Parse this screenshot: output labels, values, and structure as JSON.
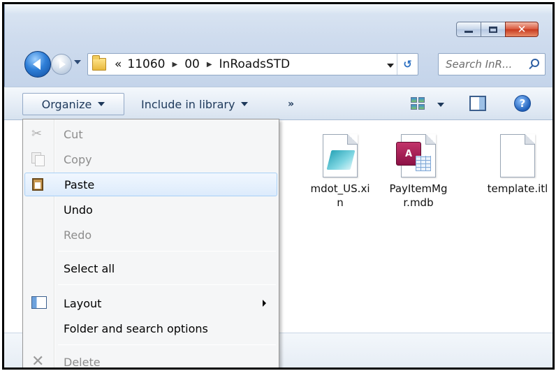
{
  "window": {
    "minimize_label": "—",
    "maximize_label": "□",
    "close_label": "✕"
  },
  "address": {
    "overflow": "«",
    "crumbs": [
      "11060",
      "00",
      "InRoadsSTD"
    ]
  },
  "search": {
    "placeholder": "Search InR..."
  },
  "toolbar": {
    "organize_label": "Organize",
    "include_label": "Include in library",
    "more_label": "»",
    "help_label": "?"
  },
  "files": [
    {
      "name": "mdot_US.xi\nn",
      "icon": "notepad-file-icon"
    },
    {
      "name": "PayItemMg\nr.mdb",
      "icon": "access-database-icon",
      "badge": "A"
    },
    {
      "name": "template.itl",
      "icon": "blank-file-icon"
    }
  ],
  "menu": {
    "items": [
      {
        "label": "Cut",
        "icon": "scissors-icon",
        "enabled": false
      },
      {
        "label": "Copy",
        "icon": "copy-icon",
        "enabled": false
      },
      {
        "label": "Paste",
        "icon": "clipboard-icon",
        "enabled": true,
        "highlighted": true
      },
      {
        "label": "Undo",
        "enabled": true
      },
      {
        "label": "Redo",
        "enabled": false
      },
      {
        "label": "Select all",
        "enabled": true
      },
      {
        "label": "Layout",
        "icon": "layout-icon",
        "enabled": true,
        "submenu": true
      },
      {
        "label": "Folder and search options",
        "enabled": true
      },
      {
        "label": "Delete",
        "icon": "delete-x-icon",
        "enabled": false
      }
    ]
  },
  "colors": {
    "chrome": "#cfdcee",
    "menu_bg": "#f5f6f7",
    "hover_border": "#a8d0f6",
    "close_button": "#c73a1f"
  }
}
